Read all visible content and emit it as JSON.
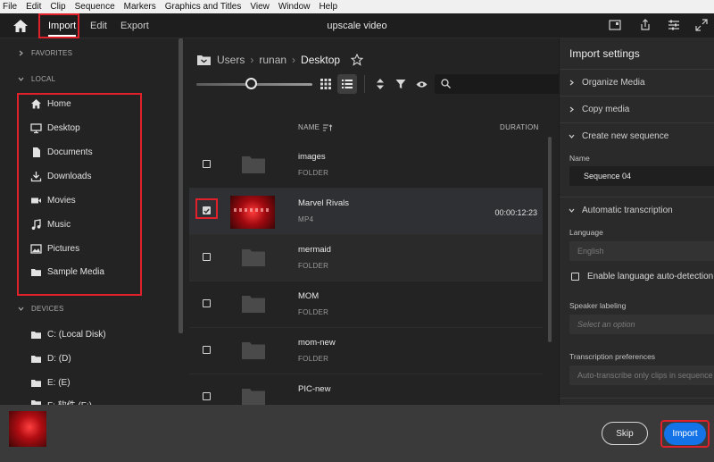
{
  "menu": [
    "File",
    "Edit",
    "Clip",
    "Sequence",
    "Markers",
    "Graphics and Titles",
    "View",
    "Window",
    "Help"
  ],
  "topbar": {
    "tabs": [
      "Import",
      "Edit",
      "Export"
    ],
    "active_tab": "Import",
    "title": "upscale video"
  },
  "sidebar": {
    "favorites_label": "FAVORITES",
    "local_label": "LOCAL",
    "local_items": [
      {
        "label": "Home",
        "icon": "home-icon"
      },
      {
        "label": "Desktop",
        "icon": "monitor-icon"
      },
      {
        "label": "Documents",
        "icon": "document-icon"
      },
      {
        "label": "Downloads",
        "icon": "download-icon"
      },
      {
        "label": "Movies",
        "icon": "video-camera-icon"
      },
      {
        "label": "Music",
        "icon": "music-note-icon"
      },
      {
        "label": "Pictures",
        "icon": "image-icon"
      },
      {
        "label": "Sample Media",
        "icon": "folder-icon"
      }
    ],
    "devices_label": "DEVICES",
    "devices": [
      "C: (Local Disk)",
      "D: (D)",
      "E: (E)",
      "F: 软件 (F:)"
    ]
  },
  "browser": {
    "breadcrumb": [
      "Users",
      "runan",
      "Desktop"
    ],
    "column_name": "NAME",
    "column_duration": "DURATION",
    "rows": [
      {
        "name": "images",
        "type": "FOLDER",
        "duration": "",
        "checked": false,
        "kind": "folder"
      },
      {
        "name": "Marvel Rivals",
        "type": "MP4",
        "duration": "00:00:12:23",
        "checked": true,
        "kind": "video"
      },
      {
        "name": "mermaid",
        "type": "FOLDER",
        "duration": "",
        "checked": false,
        "kind": "folder"
      },
      {
        "name": "MOM",
        "type": "FOLDER",
        "duration": "",
        "checked": false,
        "kind": "folder"
      },
      {
        "name": "mom-new",
        "type": "FOLDER",
        "duration": "",
        "checked": false,
        "kind": "folder"
      },
      {
        "name": "PIC-new",
        "type": "FOLDER",
        "duration": "",
        "checked": false,
        "kind": "folder"
      }
    ]
  },
  "settings": {
    "title": "Import settings",
    "organize_media": "Organize Media",
    "copy_media": "Copy media",
    "create_sequence": "Create new sequence",
    "name_label": "Name",
    "name_value": "Sequence 04",
    "automatic_transcription": "Automatic transcription",
    "language_label": "Language",
    "language_value": "English",
    "auto_detect_label": "Enable language auto-detection",
    "speaker_label": "Speaker labeling",
    "speaker_placeholder": "Select an option",
    "transcription_pref_label": "Transcription preferences",
    "transcription_pref_value": "Auto-transcribe only clips in sequence"
  },
  "footer": {
    "skip_label": "Skip",
    "import_label": "Import"
  },
  "colors": {
    "accent": "#1473e6",
    "highlight": "#e0202b"
  }
}
